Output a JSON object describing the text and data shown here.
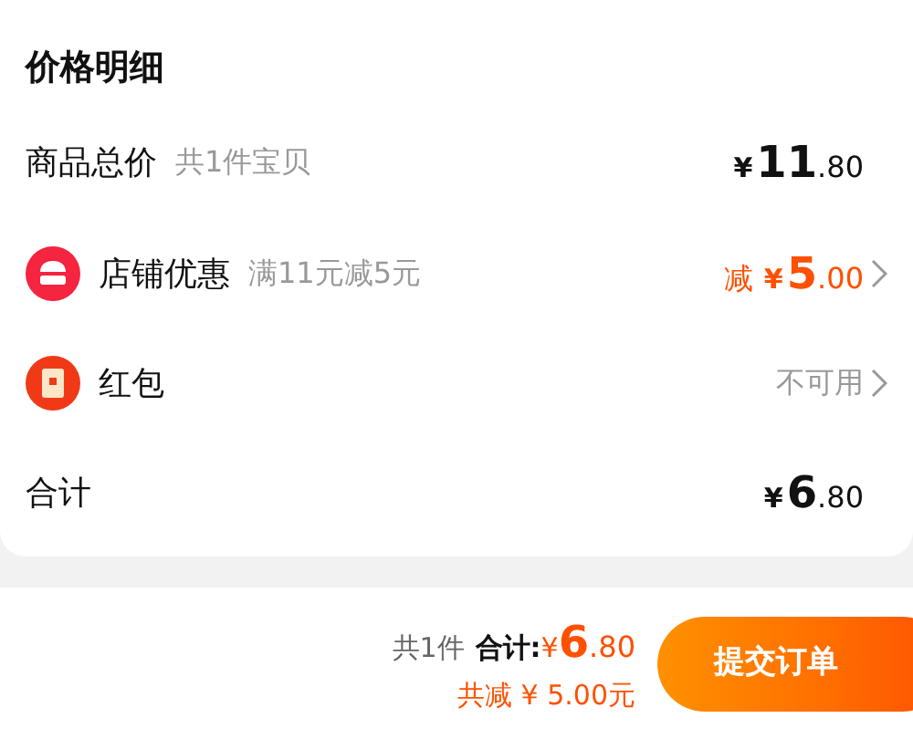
{
  "title": "价格明细",
  "rows": [
    {
      "kind": "plain",
      "label": "商品总价",
      "note": "共1件宝贝",
      "price": {
        "yen": "¥",
        "int": "11",
        "dec": ".80"
      },
      "highlight": false,
      "chevron": false
    },
    {
      "kind": "shop",
      "label": "店铺优惠",
      "note": "满11元减5元",
      "price": {
        "prefix": "减",
        "yen": "¥",
        "int": "5",
        "dec": ".00"
      },
      "highlight": true,
      "chevron": true
    },
    {
      "kind": "redpacket",
      "label": "红包",
      "value": "不可用",
      "chevron": true
    },
    {
      "kind": "plain",
      "label": "合计",
      "price": {
        "yen": "¥",
        "int": "6",
        "dec": ".80"
      },
      "highlight": false,
      "chevron": false
    }
  ],
  "footer": {
    "count": "共1件",
    "total_label": "合计:",
    "total": {
      "yen": "¥",
      "int": "6",
      "dec": ".80"
    },
    "saved": "共减 ¥ 5.00元",
    "submit": "提交订单"
  }
}
